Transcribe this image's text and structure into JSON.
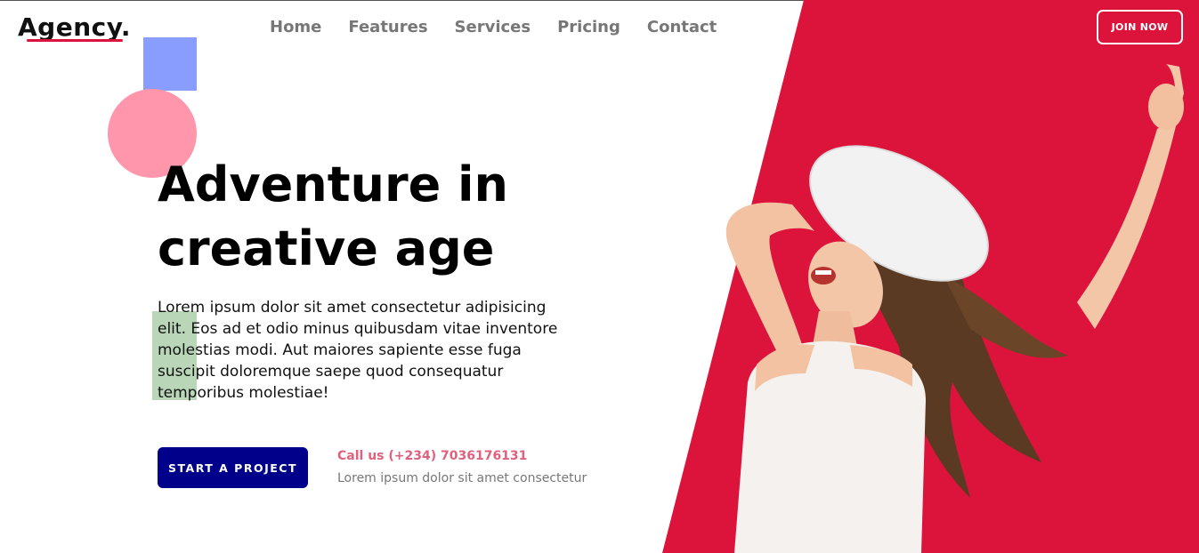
{
  "colors": {
    "accent_red": "#dc143c",
    "navy": "#00008b",
    "blue_square": "#889dfe",
    "pink_circle": "#ff96ab",
    "green_rect": "#a3c8a0",
    "call_pink": "#e0607e"
  },
  "logo": {
    "text": "Agency",
    "dot": "."
  },
  "nav": {
    "items": [
      {
        "label": "Home"
      },
      {
        "label": "Features"
      },
      {
        "label": "Services"
      },
      {
        "label": "Pricing"
      },
      {
        "label": "Contact"
      }
    ]
  },
  "header": {
    "join_label": "JOIN NOW"
  },
  "hero": {
    "title_line1": "Adventure in",
    "title_line2": "creative age",
    "description": "Lorem ipsum dolor sit amet consectetur adipisicing elit. Eos ad et odio minus quibusdam vitae inventore molestias modi. Aut maiores sapiente esse fuga suscipit doloremque saepe quod consequatur temporibus molestiae!",
    "cta_label": "START A PROJECT",
    "call_text": "Call us (+234) 7036176131",
    "call_sub": "Lorem ipsum dolor sit amet consectetur",
    "image_icon": "woman-photo"
  }
}
